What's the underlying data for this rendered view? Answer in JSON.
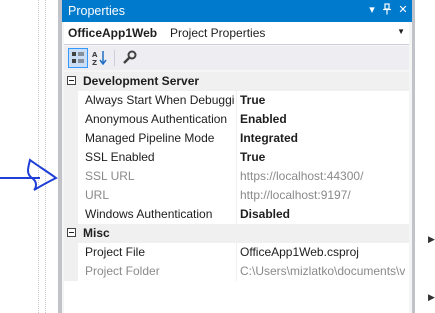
{
  "window": {
    "title": "Properties",
    "controls": [
      "dropdown-icon",
      "pin-icon",
      "close-icon"
    ]
  },
  "object_selector": {
    "name": "OfficeApp1Web",
    "type": "Project Properties"
  },
  "toolbar": {
    "buttons": [
      "categorized-icon",
      "alphabetical-icon",
      "property-pages-icon"
    ],
    "active": "categorized-icon"
  },
  "categories": [
    {
      "label": "Development Server",
      "properties": [
        {
          "name": "Always Start When Debuggi",
          "value": "True",
          "bold": true,
          "readonly": false
        },
        {
          "name": "Anonymous Authentication",
          "value": "Enabled",
          "bold": true,
          "readonly": false
        },
        {
          "name": "Managed Pipeline Mode",
          "value": "Integrated",
          "bold": true,
          "readonly": false
        },
        {
          "name": "SSL Enabled",
          "value": "True",
          "bold": true,
          "readonly": false
        },
        {
          "name": "SSL URL",
          "value": "https://localhost:44300/",
          "bold": false,
          "readonly": true
        },
        {
          "name": "URL",
          "value": "http://localhost:9197/",
          "bold": false,
          "readonly": true
        },
        {
          "name": "Windows Authentication",
          "value": "Disabled",
          "bold": true,
          "readonly": false
        }
      ]
    },
    {
      "label": "Misc",
      "properties": [
        {
          "name": "Project File",
          "value": "OfficeApp1Web.csproj",
          "bold": false,
          "readonly": false
        },
        {
          "name": "Project Folder",
          "value": "C:\\Users\\mizlatko\\documents\\vi",
          "bold": false,
          "readonly": true
        }
      ]
    }
  ],
  "colors": {
    "title_bar": "#007acc",
    "annotation_arrow": "#1f3fd6"
  }
}
